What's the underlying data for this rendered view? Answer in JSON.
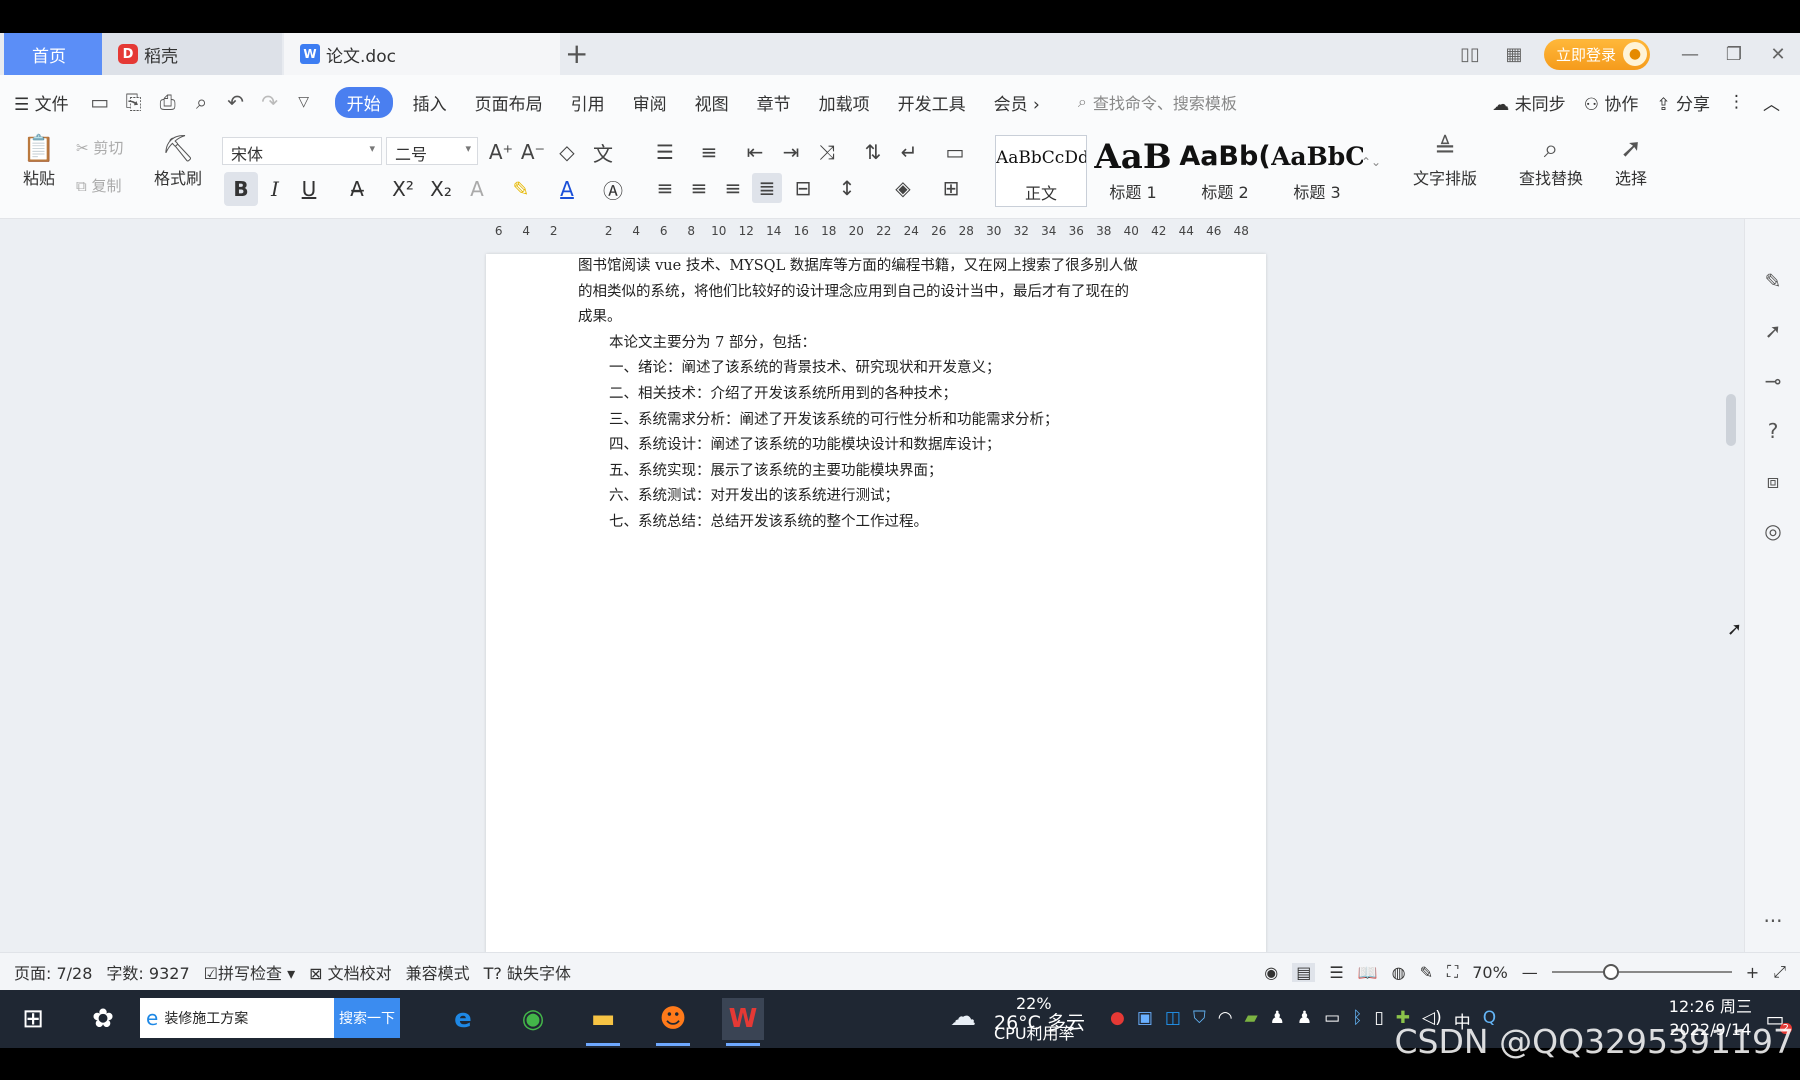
{
  "tabs": {
    "home": "首页",
    "daoke": "稻壳",
    "doc": "论文.doc",
    "daoke_logo": "D",
    "doc_logo": "W"
  },
  "titlebar": {
    "login": "立即登录"
  },
  "menu": {
    "file": "文件",
    "items": [
      "开始",
      "插入",
      "页面布局",
      "引用",
      "审阅",
      "视图",
      "章节",
      "加载项",
      "开发工具",
      "会员"
    ],
    "search_placeholder": "查找命令、搜索模板",
    "unsynced": "未同步",
    "collab": "协作",
    "share": "分享"
  },
  "ribbon": {
    "paste": "粘贴",
    "cut": "剪切",
    "copy": "复制",
    "format_painter": "格式刷",
    "font_name": "宋体",
    "font_size": "二号",
    "styles": [
      {
        "preview": "AaBbCcDd",
        "name": "正文"
      },
      {
        "preview": "AaB",
        "name": "标题 1"
      },
      {
        "preview": "AaBb(",
        "name": "标题 2"
      },
      {
        "preview": "AaBbC",
        "name": "标题 3"
      }
    ],
    "text_layout": "文字排版",
    "find_replace": "查找替换",
    "select": "选择"
  },
  "ruler": {
    "ticks": [
      "6",
      "4",
      "2",
      "",
      "2",
      "4",
      "6",
      "8",
      "10",
      "12",
      "14",
      "16",
      "18",
      "20",
      "22",
      "24",
      "26",
      "28",
      "30",
      "32",
      "34",
      "36",
      "38",
      "40",
      "42",
      "44",
      "46",
      "48"
    ]
  },
  "document": {
    "lines": [
      {
        "text": "图书馆阅读 vue 技术、MYSQL 数据库等方面的编程书籍，又在网上搜索了很多别人做",
        "indent": false
      },
      {
        "text": "的相类似的系统，将他们比较好的设计理念应用到自己的设计当中，最后才有了现在的",
        "indent": false
      },
      {
        "text": "成果。",
        "indent": false
      },
      {
        "text": "本论文主要分为 7 部分，包括：",
        "indent": true
      },
      {
        "text": "一、绪论：阐述了该系统的背景技术、研究现状和开发意义；",
        "indent": true
      },
      {
        "text": "二、相关技术：介绍了开发该系统所用到的各种技术；",
        "indent": true
      },
      {
        "text": "三、系统需求分析：阐述了开发该系统的可行性分析和功能需求分析；",
        "indent": true
      },
      {
        "text": "四、系统设计：阐述了该系统的功能模块设计和数据库设计；",
        "indent": true
      },
      {
        "text": "五、系统实现：展示了该系统的主要功能模块界面；",
        "indent": true
      },
      {
        "text": "六、系统测试：对开发出的该系统进行测试；",
        "indent": true
      },
      {
        "text": "七、系统总结：总结开发该系统的整个工作过程。",
        "indent": true
      }
    ]
  },
  "status": {
    "page": "页面: 7/28",
    "words": "字数: 9327",
    "spellcheck": "拼写检查",
    "proofread": "文档校对",
    "compat": "兼容模式",
    "missing_font": "缺失字体",
    "zoom": "70%",
    "zoom_level": 0.33
  },
  "taskbar": {
    "search_text": "装修施工方案",
    "search_button": "搜索一下",
    "weather": "26°C 多云",
    "cpu": "22%",
    "cpu_label": "CPU利用率",
    "ime": "中",
    "time": "12:26 周三",
    "date": "2022/9/14",
    "notify_count": "2"
  },
  "watermark": "CSDN @QQ3295391197",
  "colors": {
    "accent": "#4a7ff0",
    "home_tab": "#5b8ef7",
    "login": "#f5a623",
    "taskbar": "#1f2733"
  }
}
